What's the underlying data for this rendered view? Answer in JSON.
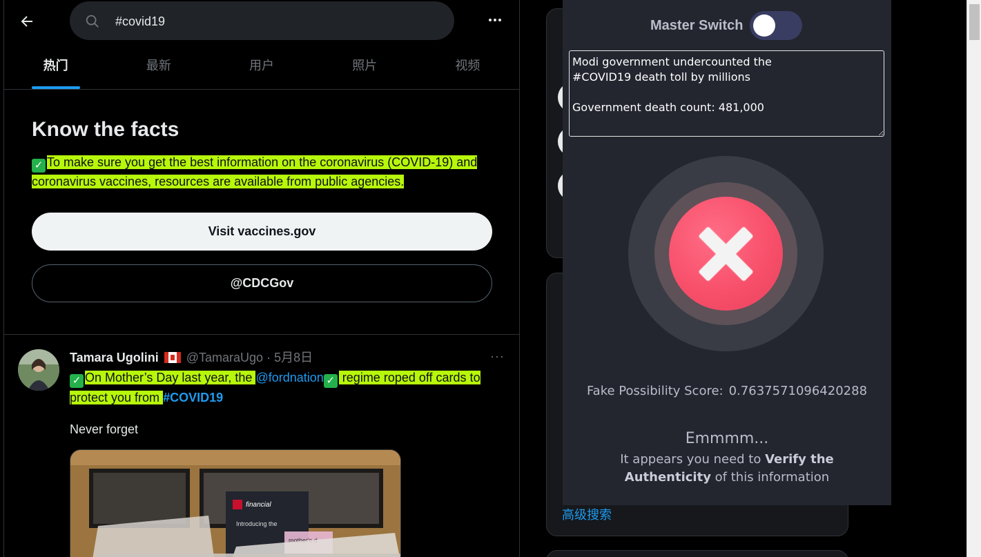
{
  "topbar": {
    "back_icon": "arrow-left-icon",
    "search_value": "#covid19",
    "more_icon": "ellipsis-icon"
  },
  "tabs": [
    {
      "label": "热门",
      "active": true
    },
    {
      "label": "最新",
      "active": false
    },
    {
      "label": "用户",
      "active": false
    },
    {
      "label": "照片",
      "active": false
    },
    {
      "label": "视频",
      "active": false
    }
  ],
  "facts": {
    "title": "Know the facts",
    "check_icon": "✓",
    "text": "To make sure you get the best information on the coronavirus (COVID-19) and coronavirus vaccines, resources are available from public agencies.",
    "primary_button": "Visit vaccines.gov",
    "secondary_button": "@CDCGov"
  },
  "tweet": {
    "name": "Tamara Ugolini",
    "handle": "@TamaraUgo",
    "separator": "·",
    "date": "5月8日",
    "more": "···",
    "text_part1": "On Mother’s Day last year, the ",
    "mention": "@fordnation",
    "text_part2": " regime roped off cards to protect you from ",
    "hashtag": "#COVID19",
    "extra": "Never forget"
  },
  "right": {
    "advanced_search": "高级搜索"
  },
  "popup": {
    "master_label": "Master Switch",
    "master_on": false,
    "claim_text": "Modi government undercounted the\n#COVID19 death toll by millions\n\nGovernment death count: 481,000",
    "score_label": "Fake Possibility Score:",
    "score_value": "0.7637571096420288",
    "verdict_title": "Emmmm...",
    "verdict_pre": "It appears you need to ",
    "verdict_bold": "Verify the Authenticity",
    "verdict_post": " of this information",
    "colors": {
      "accent_red": "#f8506b",
      "bg": "#23262f",
      "toggle": "#3a3d62"
    }
  },
  "colors": {
    "highlight": "#b7f70b",
    "link": "#1d9bf0",
    "tab_indicator": "#1d9bf0"
  }
}
